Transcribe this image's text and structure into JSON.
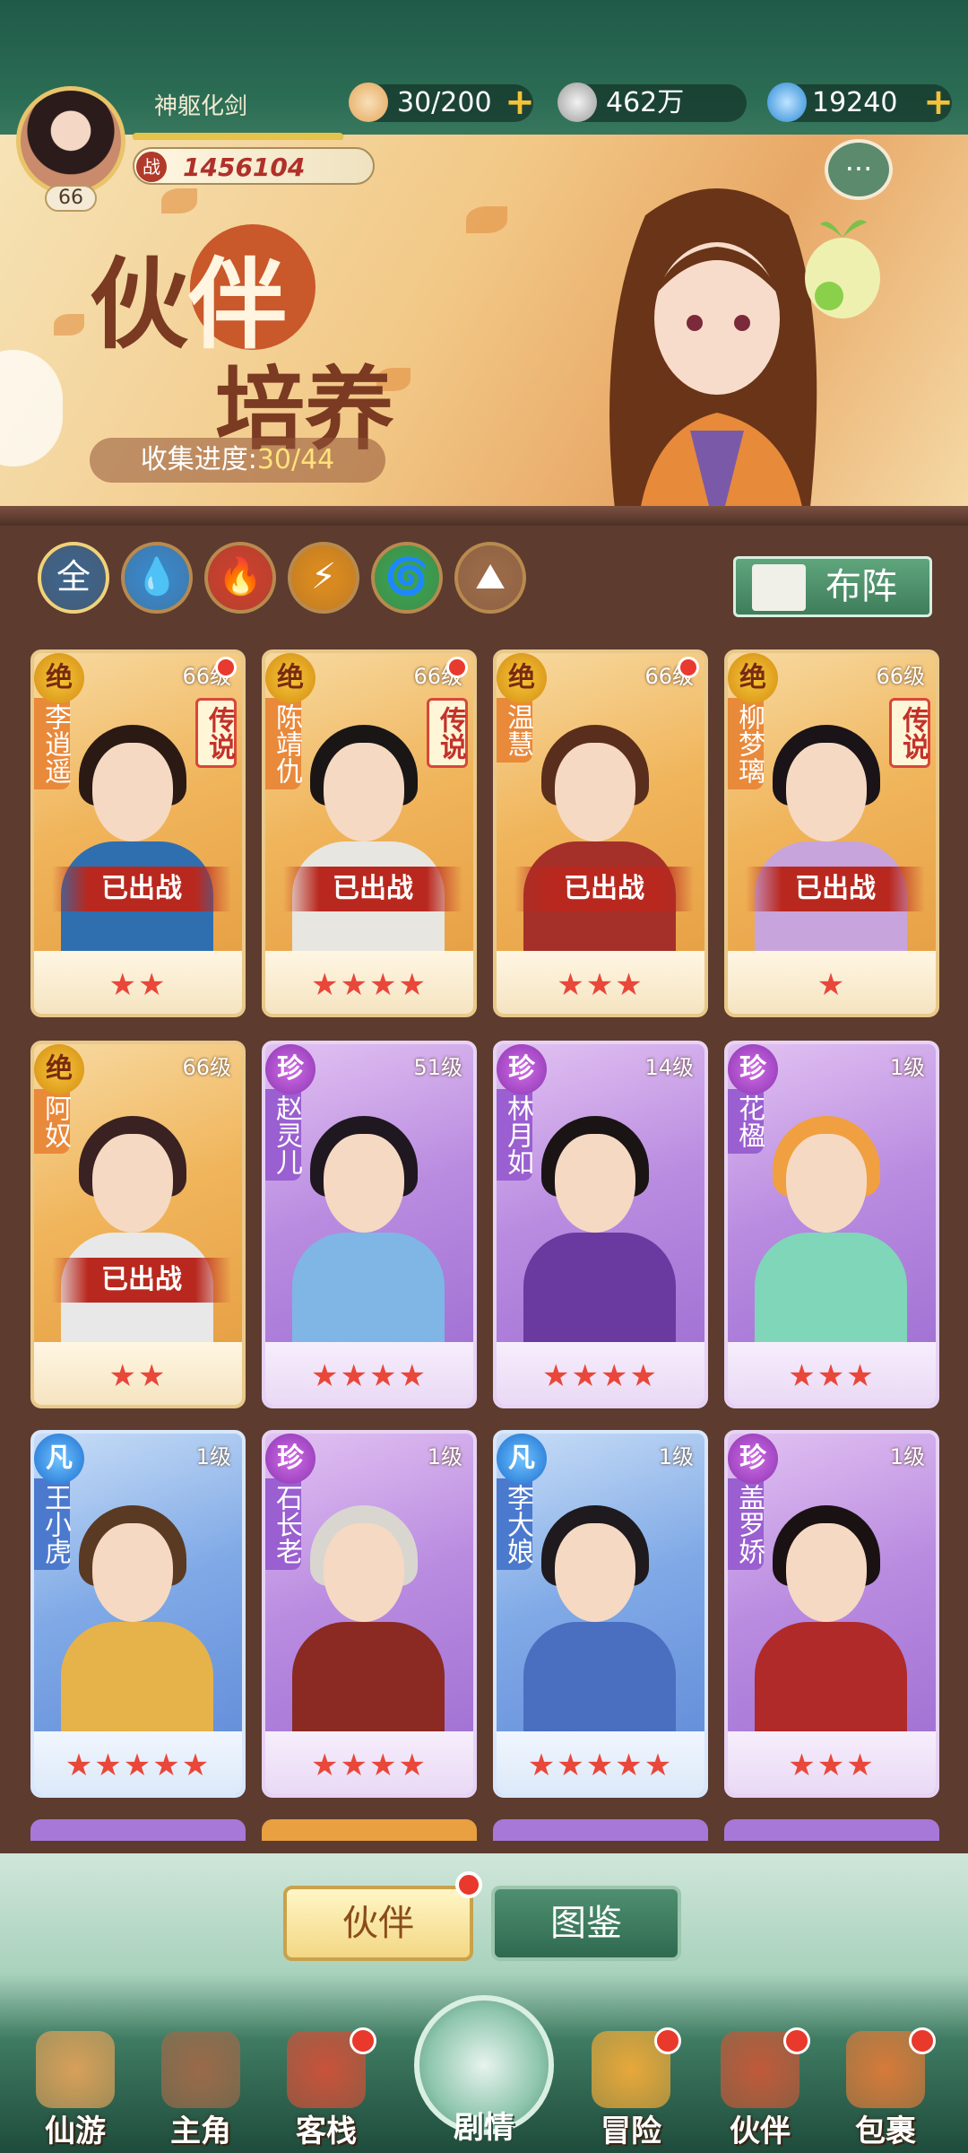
{
  "player": {
    "name": "神躯化剑",
    "level": "66",
    "power_icon": "战",
    "power": "1456104",
    "xp_fraction": 1.0
  },
  "resources": [
    {
      "icon": "bun-icon",
      "value": "30/200",
      "plus": "+"
    },
    {
      "icon": "coin-icon",
      "value": "462万",
      "plus": ""
    },
    {
      "icon": "jade-icon",
      "value": "19240",
      "plus": "+"
    }
  ],
  "banner": {
    "title_a": "伙",
    "title_b": "伴",
    "title_c": "培养",
    "progress_label": "收集进度:",
    "progress_value": "30/44",
    "chat_icon": "···"
  },
  "filters": [
    {
      "name": "all",
      "label": "全",
      "color": "#3f6388"
    },
    {
      "name": "water",
      "label": "💧",
      "color": "#3a86c6"
    },
    {
      "name": "fire",
      "label": "🔥",
      "color": "#c9402e"
    },
    {
      "name": "thunder",
      "label": "⚡",
      "color": "#d88a20"
    },
    {
      "name": "wind",
      "label": "🌀",
      "color": "#3aa050"
    },
    {
      "name": "earth",
      "label": "⛰",
      "color": "#9a6a48"
    }
  ],
  "formation_button": "布阵",
  "cards": [
    {
      "grade": "绝",
      "style": "gold",
      "name": "李逍遥",
      "level": "66级",
      "rare": "传说",
      "status": "已出战",
      "stars": "★★",
      "dot": true,
      "hair": "#2b1a14",
      "cloth": "#2f6fb0"
    },
    {
      "grade": "绝",
      "style": "gold",
      "name": "陈靖仇",
      "level": "66级",
      "rare": "传说",
      "status": "已出战",
      "stars": "★★★★",
      "dot": true,
      "hair": "#1a1616",
      "cloth": "#e8e6e0"
    },
    {
      "grade": "绝",
      "style": "gold",
      "name": "温慧",
      "level": "66级",
      "rare": "",
      "status": "已出战",
      "stars": "★★★",
      "dot": true,
      "hair": "#5a2e1c",
      "cloth": "#a5302a"
    },
    {
      "grade": "绝",
      "style": "gold",
      "name": "柳梦璃",
      "level": "66级",
      "rare": "传说",
      "status": "已出战",
      "stars": "★",
      "dot": false,
      "hair": "#1a1418",
      "cloth": "#c8a4dc"
    },
    {
      "grade": "绝",
      "style": "gold",
      "name": "阿奴",
      "level": "66级",
      "rare": "",
      "status": "已出战",
      "stars": "★★",
      "dot": false,
      "hair": "#3a2222",
      "cloth": "#e8e8e8"
    },
    {
      "grade": "珍",
      "style": "purple",
      "name": "赵灵儿",
      "level": "51级",
      "rare": "",
      "status": "",
      "stars": "★★★★",
      "dot": false,
      "hair": "#1f1820",
      "cloth": "#7fb6e6"
    },
    {
      "grade": "珍",
      "style": "purple",
      "name": "林月如",
      "level": "14级",
      "rare": "",
      "status": "",
      "stars": "★★★★",
      "dot": false,
      "hair": "#1a1414",
      "cloth": "#6a3aa0"
    },
    {
      "grade": "珍",
      "style": "purple",
      "name": "花楹",
      "level": "1级",
      "rare": "",
      "status": "",
      "stars": "★★★",
      "dot": false,
      "hair": "#f0a040",
      "cloth": "#7fd6b8"
    },
    {
      "grade": "凡",
      "style": "blue",
      "name": "王小虎",
      "level": "1级",
      "rare": "",
      "status": "",
      "stars": "★★★★★",
      "dot": false,
      "hair": "#5a3a22",
      "cloth": "#e6b24a"
    },
    {
      "grade": "珍",
      "style": "purple",
      "name": "石长老",
      "level": "1级",
      "rare": "",
      "status": "",
      "stars": "★★★★",
      "dot": false,
      "hair": "#d9d6d0",
      "cloth": "#8a2a22"
    },
    {
      "grade": "凡",
      "style": "blue",
      "name": "李大娘",
      "level": "1级",
      "rare": "",
      "status": "",
      "stars": "★★★★★",
      "dot": false,
      "hair": "#1e1a1e",
      "cloth": "#4a6fc0"
    },
    {
      "grade": "珍",
      "style": "purple",
      "name": "盖罗娇",
      "level": "1级",
      "rare": "",
      "status": "",
      "stars": "★★★",
      "dot": false,
      "hair": "#1a1212",
      "cloth": "#b02a2a"
    }
  ],
  "bottom_tabs": {
    "partner": "伙伴",
    "atlas": "图鉴"
  },
  "nav": [
    {
      "label": "仙游",
      "icon": "scroll-icon",
      "color": "#d8a05a",
      "dot": false
    },
    {
      "label": "主角",
      "icon": "hero-icon",
      "color": "#9a6a4a",
      "dot": false
    },
    {
      "label": "客栈",
      "icon": "inn-icon",
      "color": "#c9523a",
      "dot": true
    },
    {
      "label": "剧情",
      "icon": "story-icon",
      "color": "",
      "dot": false
    },
    {
      "label": "冒险",
      "icon": "gourd-icon",
      "color": "#e8a83a",
      "dot": true
    },
    {
      "label": "伙伴",
      "icon": "cards-icon",
      "color": "#c05a3a",
      "dot": true
    },
    {
      "label": "包裹",
      "icon": "bag-icon",
      "color": "#d67a3a",
      "dot": true
    }
  ]
}
